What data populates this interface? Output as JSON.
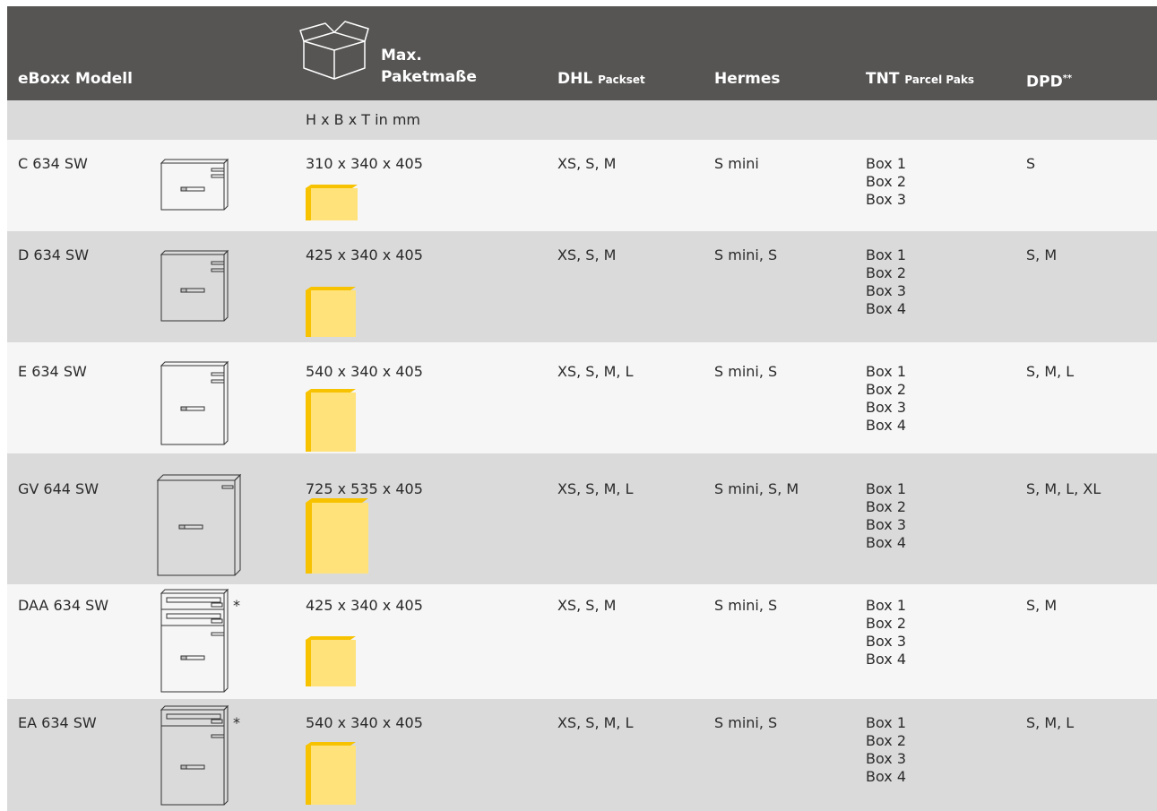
{
  "header": {
    "model": "eBoxx Modell",
    "max_line1": "Max.",
    "max_line2": "Paketmaße",
    "dhl": "DHL",
    "dhl_small": "Packset",
    "hermes": "Hermes",
    "tnt": "TNT",
    "tnt_small": "Parcel Paks",
    "dpd": "DPD",
    "dpd_sup": "**"
  },
  "subheader": {
    "units": "H x B x T in mm"
  },
  "icons": {
    "box_outline": "box-outline-icon",
    "mailbox": "mailbox-icon",
    "package": "package-icon"
  },
  "colors": {
    "header_bg": "#565554",
    "row_grey": "#dadada",
    "row_white": "#f6f6f6",
    "package_yellow": "#f7c200",
    "package_light": "#ffe27a"
  },
  "rows": [
    {
      "model": "C 634 SW",
      "dims": "310 x 340 x 405",
      "dhl": "XS, S, M",
      "hermes": "S mini",
      "tnt": [
        "Box 1",
        "Box 2",
        "Box 3"
      ],
      "dpd": "S",
      "asterisk": ""
    },
    {
      "model": "D 634 SW",
      "dims": "425 x 340 x 405",
      "dhl": "XS, S, M",
      "hermes": "S mini, S",
      "tnt": [
        "Box 1",
        "Box 2",
        "Box 3",
        "Box 4"
      ],
      "dpd": "S, M",
      "asterisk": ""
    },
    {
      "model": "E 634 SW",
      "dims": "540 x 340 x 405",
      "dhl": "XS, S, M, L",
      "hermes": "S mini, S",
      "tnt": [
        "Box 1",
        "Box 2",
        "Box 3",
        "Box 4"
      ],
      "dpd": "S, M, L",
      "asterisk": ""
    },
    {
      "model": "GV 644 SW",
      "dims": "725 x 535 x 405",
      "dhl": "XS, S, M, L",
      "hermes": "S mini, S, M",
      "tnt": [
        "Box 1",
        "Box 2",
        "Box 3",
        "Box 4"
      ],
      "dpd": "S, M, L, XL",
      "asterisk": ""
    },
    {
      "model": "DAA 634 SW",
      "dims": "425 x 340 x 405",
      "dhl": "XS, S, M",
      "hermes": "S mini, S",
      "tnt": [
        "Box 1",
        "Box 2",
        "Box 3",
        "Box 4"
      ],
      "dpd": "S, M",
      "asterisk": "*"
    },
    {
      "model": "EA 634 SW",
      "dims": "540 x 340 x 405",
      "dhl": "XS, S, M, L",
      "hermes": "S mini, S",
      "tnt": [
        "Box 1",
        "Box 2",
        "Box 3",
        "Box 4"
      ],
      "dpd": "S, M, L",
      "asterisk": "*"
    }
  ]
}
